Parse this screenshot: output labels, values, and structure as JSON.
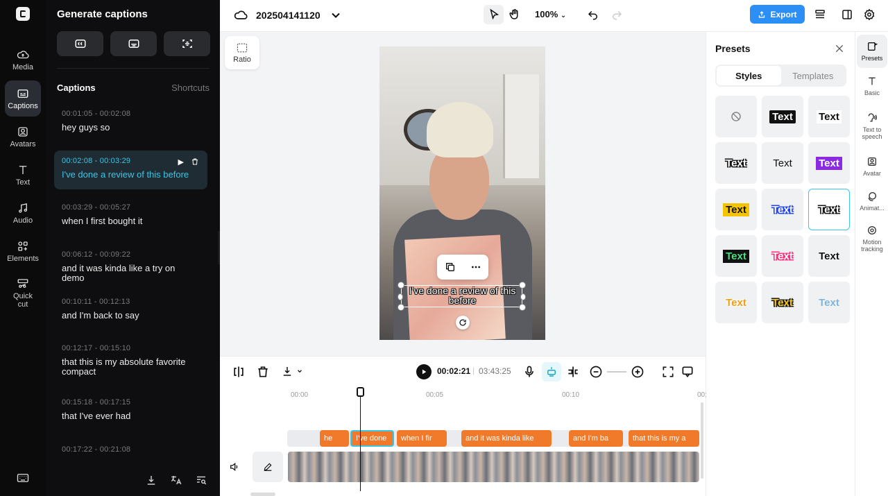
{
  "rail": {
    "items": [
      {
        "label": "Media"
      },
      {
        "label": "Captions"
      },
      {
        "label": "Avatars"
      },
      {
        "label": "Text"
      },
      {
        "label": "Audio"
      },
      {
        "label": "Elements"
      },
      {
        "label": "Quick cut"
      }
    ]
  },
  "panel": {
    "title": "Generate captions",
    "captions_heading": "Captions",
    "shortcuts_label": "Shortcuts",
    "captions": [
      {
        "time": "00:01:05 - 00:02:08",
        "text": "hey guys so"
      },
      {
        "time": "00:02:08 - 00:03:29",
        "text": "I've done a review of this before"
      },
      {
        "time": "00:03:29 - 00:05:27",
        "text": "when I first bought it"
      },
      {
        "time": "00:06:12 - 00:09:22",
        "text": "and it was kinda like a try on demo"
      },
      {
        "time": "00:10:11 - 00:12:13",
        "text": "and I'm back to say"
      },
      {
        "time": "00:12:17 - 00:15:10",
        "text": "that this is my absolute favorite compact"
      },
      {
        "time": "00:15:18 - 00:17:15",
        "text": "that I've ever had"
      },
      {
        "time": "00:17:22 - 00:21:08",
        "text": ""
      }
    ]
  },
  "topbar": {
    "project_name": "202504141120",
    "zoom": "100%",
    "export_label": "Export"
  },
  "stage": {
    "ratio_label": "Ratio",
    "caption_text": "I've done a review of this before"
  },
  "presets": {
    "title": "Presets",
    "tabs": [
      "Styles",
      "Templates"
    ],
    "cells": [
      "",
      "Text",
      "Text",
      "Text",
      "Text",
      "Text",
      "Text",
      "Text",
      "Text",
      "Text",
      "Text",
      "Text",
      "Text",
      "Text",
      "Text"
    ]
  },
  "right_rail": {
    "items": [
      {
        "label": "Presets"
      },
      {
        "label": "Basic"
      },
      {
        "label": "Text to speech"
      },
      {
        "label": "Avatar"
      },
      {
        "label": "Animat..."
      },
      {
        "label": "Motion tracking"
      }
    ]
  },
  "timeline": {
    "current_time": "00:02:21",
    "total_time": "03:43:25",
    "ruler": [
      "00:00",
      "00:05",
      "00:10",
      "00:"
    ],
    "clips": [
      "he",
      "I've done",
      "when I fir",
      "and it was kinda like",
      "and I'm ba",
      "that this is my a"
    ]
  },
  "colors": {
    "accent": "#3cc6e3",
    "clip": "#f07a2a",
    "export": "#2b8ff5"
  }
}
